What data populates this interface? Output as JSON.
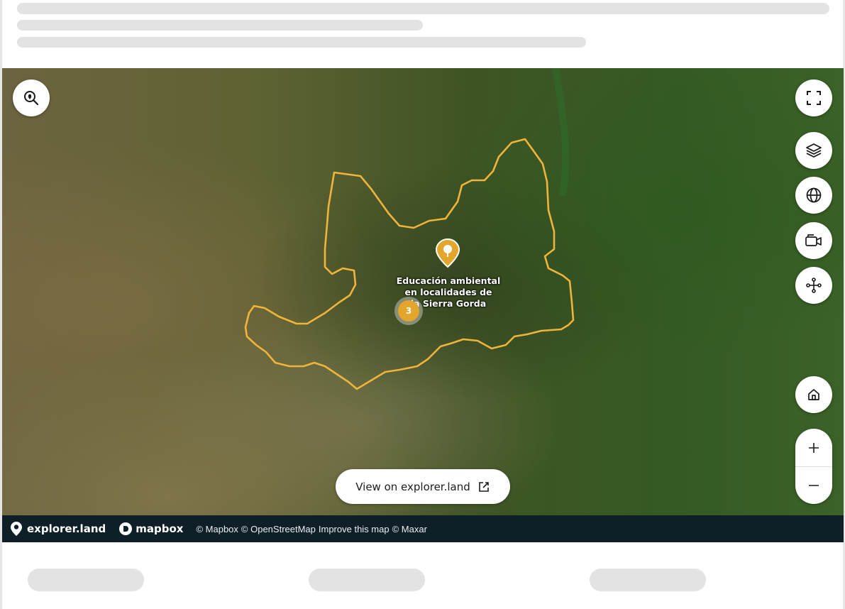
{
  "map": {
    "project_label_lines": [
      "Educación ambiental",
      "en localidades de",
      "la Sierra Gorda"
    ],
    "cluster_count": "3",
    "accent_color": "#e3a52c",
    "boundary_color": "#f0b43a",
    "basemap": "satellite"
  },
  "controls": {
    "search_icon": "search-location-icon",
    "fullscreen_icon": "fullscreen-icon",
    "layers_icon": "layers-icon",
    "globe_icon": "globe-icon",
    "camera_icon": "video-camera-icon",
    "network_icon": "network-icon",
    "home_icon": "home-icon",
    "zoom_in": "+",
    "zoom_out": "−"
  },
  "view_button": {
    "label": "View on explorer.land",
    "icon": "external-link-icon"
  },
  "attribution": {
    "brand": "explorer.land",
    "mapbox": "mapbox",
    "credits": [
      "© Mapbox",
      "© OpenStreetMap",
      "Improve this map",
      "© Maxar"
    ]
  }
}
